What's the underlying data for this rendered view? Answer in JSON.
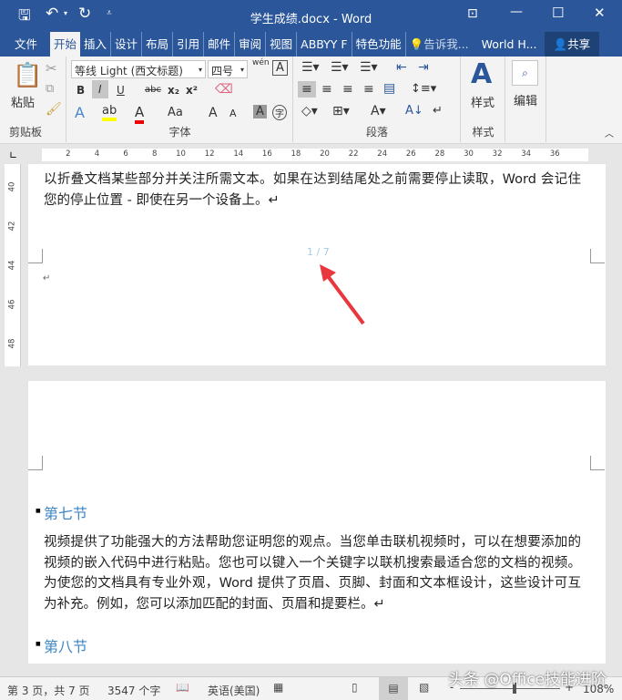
{
  "title": "学生成绩.docx - Word",
  "tabs": [
    "文件",
    "开始",
    "插入",
    "设计",
    "布局",
    "引用",
    "邮件",
    "审阅",
    "视图",
    "ABBYY F",
    "特色功能"
  ],
  "tell_me": "告诉我...",
  "account": "World H...",
  "share": "共享",
  "ribbon": {
    "clipboard": {
      "paste": "粘贴",
      "label": "剪贴板"
    },
    "font": {
      "name": "等线 Light (西文标题)",
      "size": "四号",
      "label": "字体",
      "bold": "B",
      "italic": "I",
      "underline": "U",
      "strike": "abc",
      "sub": "x₂",
      "sup": "x²",
      "case": "Aa",
      "grow": "A",
      "shrink": "A",
      "shade": "A",
      "enclose": "字",
      "phonetic": "wén"
    },
    "paragraph": {
      "label": "段落"
    },
    "styles": {
      "button": "样式",
      "label": "样式"
    },
    "editing": {
      "button": "编辑"
    }
  },
  "ruler_ticks": [
    "2",
    "4",
    "6",
    "8",
    "10",
    "12",
    "14",
    "16",
    "18",
    "20",
    "22",
    "24",
    "26",
    "28",
    "30",
    "32",
    "34",
    "36"
  ],
  "vruler_ticks": [
    "40",
    "42",
    "44",
    "46",
    "48"
  ],
  "page1": {
    "text": "以折叠文档某些部分并关注所需文本。如果在达到结尾处之前需要停止读取，Word 会记住您的停止位置 - 即使在另一个设备上。↵",
    "page_number": "1 / 7",
    "mark": "↵"
  },
  "page2": {
    "heading1": "第七节",
    "para": "视频提供了功能强大的方法帮助您证明您的观点。当您单击联机视频时，可以在想要添加的视频的嵌入代码中进行粘贴。您也可以键入一个关键字以联机搜索最适合您的文档的视频。为使您的文档具有专业外观，Word 提供了页眉、页脚、封面和文本框设计，这些设计可互为补充。例如，您可以添加匹配的封面、页眉和提要栏。↵",
    "heading2": "第八节",
    "mark": "↵"
  },
  "status": {
    "page": "第 3 页，共 7 页",
    "words": "3547 个字",
    "language": "英语(美国)",
    "zoom": "108%"
  },
  "watermark": "头条 @Office技能进阶"
}
